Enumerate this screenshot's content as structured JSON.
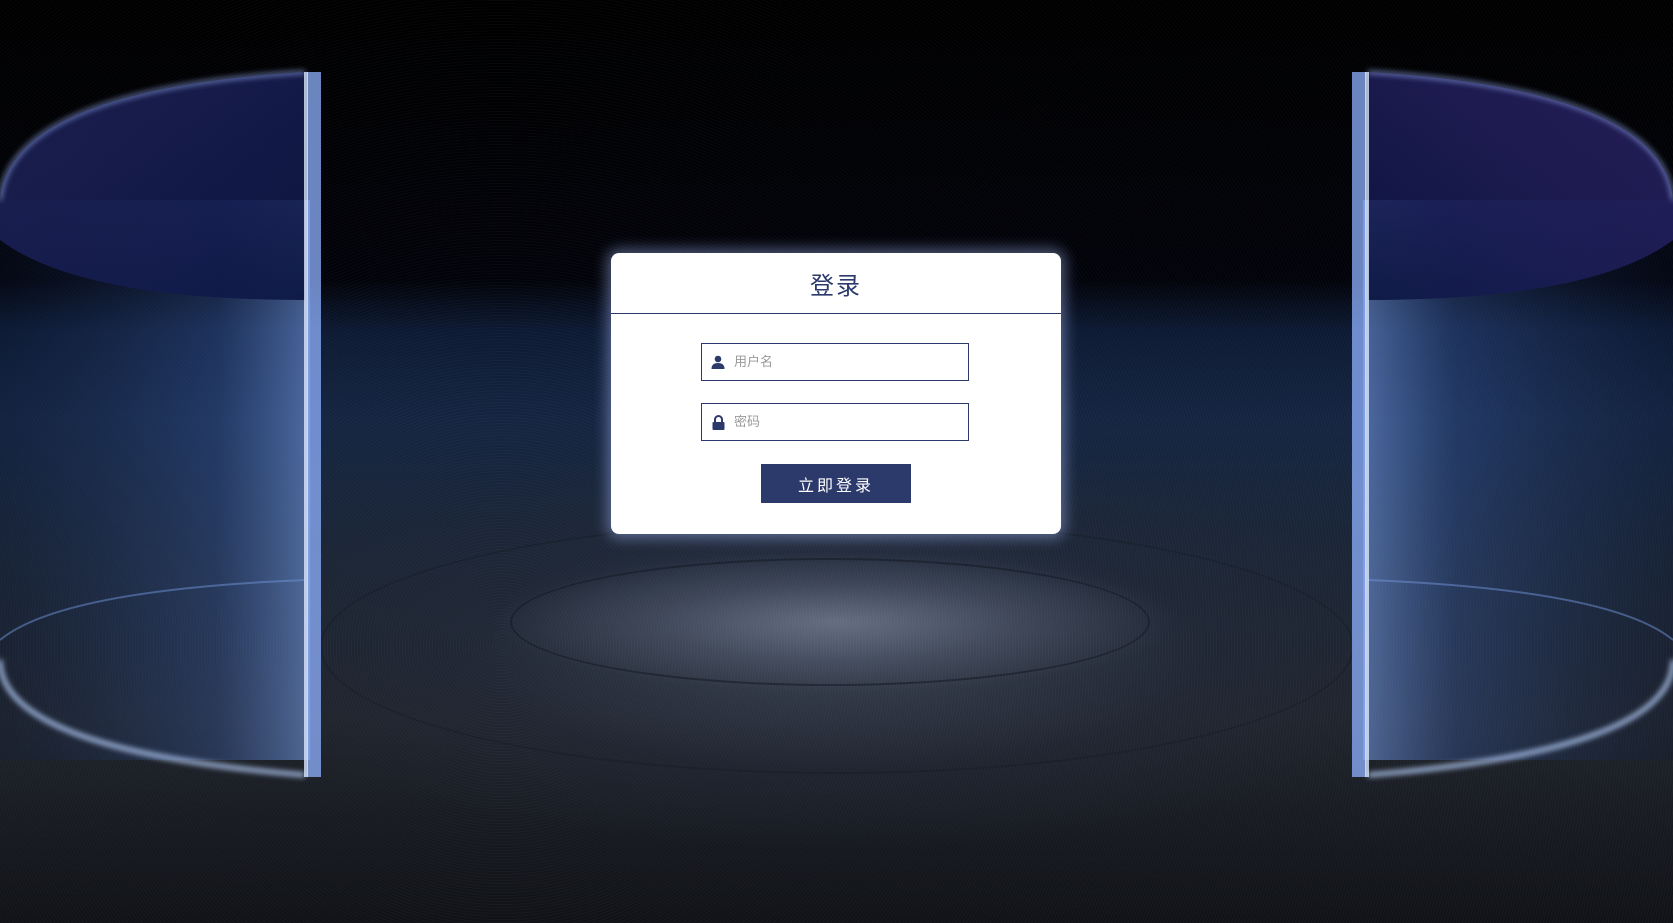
{
  "login": {
    "title": "登录",
    "username": {
      "placeholder": "用户名",
      "value": ""
    },
    "password": {
      "placeholder": "密码",
      "value": ""
    },
    "submit_label": "立即登录"
  },
  "icons": {
    "username": "user-icon",
    "password": "lock-icon"
  },
  "colors": {
    "accent": "#2b3a6b",
    "card_background": "#ffffff",
    "page_background": "#000000",
    "glow": "#8fb2ff"
  }
}
